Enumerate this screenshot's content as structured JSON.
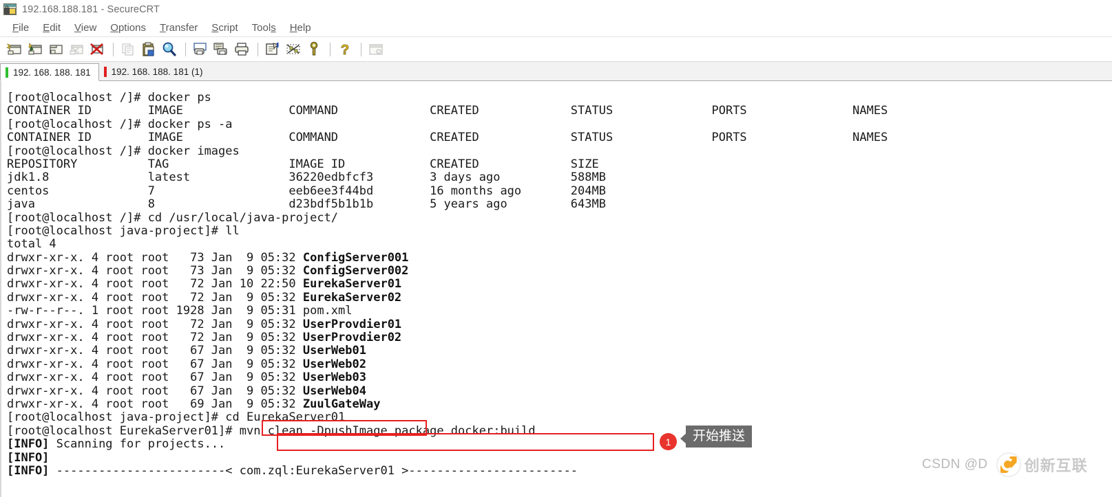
{
  "window": {
    "title": "192.168.188.181 - SecureCRT",
    "icon": "securecrt-icon"
  },
  "menubar": {
    "items": [
      {
        "label": "File",
        "accel_index": 0
      },
      {
        "label": "Edit",
        "accel_index": 0
      },
      {
        "label": "View",
        "accel_index": 0
      },
      {
        "label": "Options",
        "accel_index": 0
      },
      {
        "label": "Transfer",
        "accel_index": 0
      },
      {
        "label": "Script",
        "accel_index": 0
      },
      {
        "label": "Tools",
        "accel_index": 4
      },
      {
        "label": "Help",
        "accel_index": 0
      }
    ]
  },
  "toolbar": {
    "buttons": [
      {
        "name": "connect-icon",
        "enabled": true
      },
      {
        "name": "quick-connect-icon",
        "enabled": true
      },
      {
        "name": "connect-in-tab-icon",
        "enabled": true
      },
      {
        "name": "connect-sftp-icon",
        "enabled": false
      },
      {
        "name": "disconnect-icon",
        "enabled": true
      },
      {
        "name": "separator",
        "enabled": false
      },
      {
        "name": "copy-icon",
        "enabled": false
      },
      {
        "name": "paste-icon",
        "enabled": true
      },
      {
        "name": "find-icon",
        "enabled": true
      },
      {
        "name": "separator",
        "enabled": false
      },
      {
        "name": "print-screen-icon",
        "enabled": true
      },
      {
        "name": "log-session-icon",
        "enabled": true
      },
      {
        "name": "print-icon",
        "enabled": true
      },
      {
        "name": "separator",
        "enabled": false
      },
      {
        "name": "session-options-icon",
        "enabled": true
      },
      {
        "name": "toggle-raw-icon",
        "enabled": true
      },
      {
        "name": "key-icon",
        "enabled": true
      },
      {
        "name": "separator",
        "enabled": false
      },
      {
        "name": "help-icon",
        "enabled": true
      },
      {
        "name": "separator",
        "enabled": false
      },
      {
        "name": "about-icon",
        "enabled": false
      }
    ]
  },
  "tabs": [
    {
      "label": "192. 168. 188. 181",
      "indicator_color": "#2fbf2f",
      "active": true
    },
    {
      "label": "192. 168. 188. 181 (1)",
      "indicator_color": "#e02020",
      "active": false
    }
  ],
  "terminal": {
    "lines": [
      "[root@localhost /]# docker ps",
      "CONTAINER ID        IMAGE               COMMAND             CREATED             STATUS              PORTS               NAMES",
      "[root@localhost /]# docker ps -a",
      "CONTAINER ID        IMAGE               COMMAND             CREATED             STATUS              PORTS               NAMES",
      "[root@localhost /]# docker images",
      "REPOSITORY          TAG                 IMAGE ID            CREATED             SIZE",
      "jdk1.8              latest              36220edbfcf3        3 days ago          588MB",
      "centos              7                   eeb6ee3f44bd        16 months ago       204MB",
      "java                8                   d23bdf5b1b1b        5 years ago         643MB",
      "[root@localhost /]# cd /usr/local/java-project/",
      "[root@localhost java-project]# ll",
      "total 4",
      "drwxr-xr-x. 4 root root   73 Jan  9 05:32 <b>ConfigServer001</b>",
      "drwxr-xr-x. 4 root root   73 Jan  9 05:32 <b>ConfigServer002</b>",
      "drwxr-xr-x. 4 root root   72 Jan 10 22:50 <b>EurekaServer01</b>",
      "drwxr-xr-x. 4 root root   72 Jan  9 05:32 <b>EurekaServer02</b>",
      "-rw-r--r--. 1 root root 1928 Jan  9 05:31 pom.xml",
      "drwxr-xr-x. 4 root root   72 Jan  9 05:32 <b>UserProvdier01</b>",
      "drwxr-xr-x. 4 root root   72 Jan  9 05:32 <b>UserProvdier02</b>",
      "drwxr-xr-x. 4 root root   67 Jan  9 05:32 <b>UserWeb01</b>",
      "drwxr-xr-x. 4 root root   67 Jan  9 05:32 <b>UserWeb02</b>",
      "drwxr-xr-x. 4 root root   67 Jan  9 05:32 <b>UserWeb03</b>",
      "drwxr-xr-x. 4 root root   67 Jan  9 05:32 <b>UserWeb04</b>",
      "drwxr-xr-x. 4 root root   69 Jan  9 05:32 <b>ZuulGateWay</b>",
      "[root@localhost java-project]# cd EurekaServer01",
      "[root@localhost EurekaServer01]# mvn clean -DpushImage package docker:build",
      "<b>[INFO]</b> Scanning for projects...",
      "<b>[INFO]</b>",
      "<b>[INFO]</b> ------------------------&lt; com.zql:EurekaServer01 &gt;------------------------"
    ]
  },
  "annotations": {
    "box_cd_command": "cd EurekaServer01",
    "box_mvn_command": "mvn clean -DpushImage package docker:build",
    "badge_number": "1",
    "tooltip_text": "开始推送",
    "accent_color": "#e62020",
    "badge_color": "#e8342c",
    "tooltip_bg": "#6b6b6b"
  },
  "watermark": {
    "text": "CSDN @D",
    "logo_text": "创新互联"
  }
}
